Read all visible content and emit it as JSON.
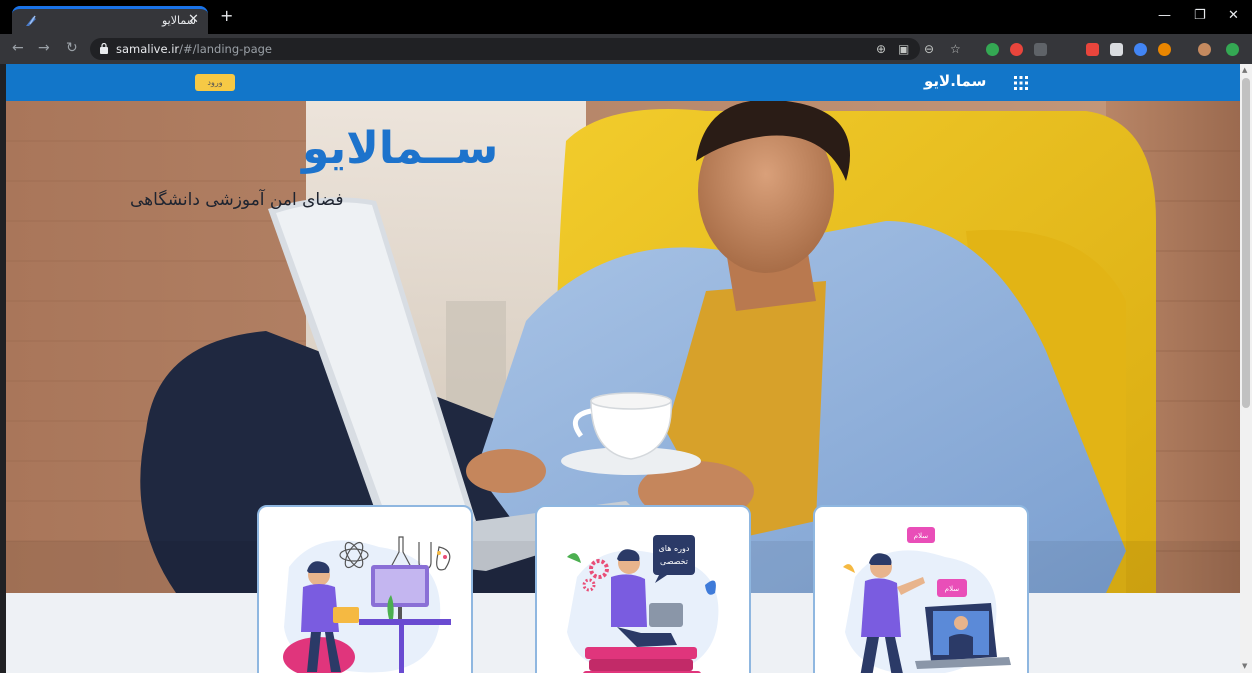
{
  "browser": {
    "tab_title": "سمالایو",
    "url_domain": "samalive.ir",
    "url_path": "/#/landing-page"
  },
  "site": {
    "brand": "سما.لایو",
    "login_label": "ورود",
    "hero_logo": "ســمالایو",
    "hero_tagline": "فضای امن آموزشی دانشگاهی"
  },
  "cards": [
    {
      "name": "learning-illustration"
    },
    {
      "name": "courses-illustration",
      "bubble": "دوره های تخصصی"
    },
    {
      "name": "chat-illustration",
      "bubble_1": "سلام",
      "bubble_2": "سلام"
    }
  ],
  "colors": {
    "header": "#1276c9",
    "login_button": "#f6c945",
    "logo": "#1d73cc",
    "card_border": "#8fb7e0"
  }
}
